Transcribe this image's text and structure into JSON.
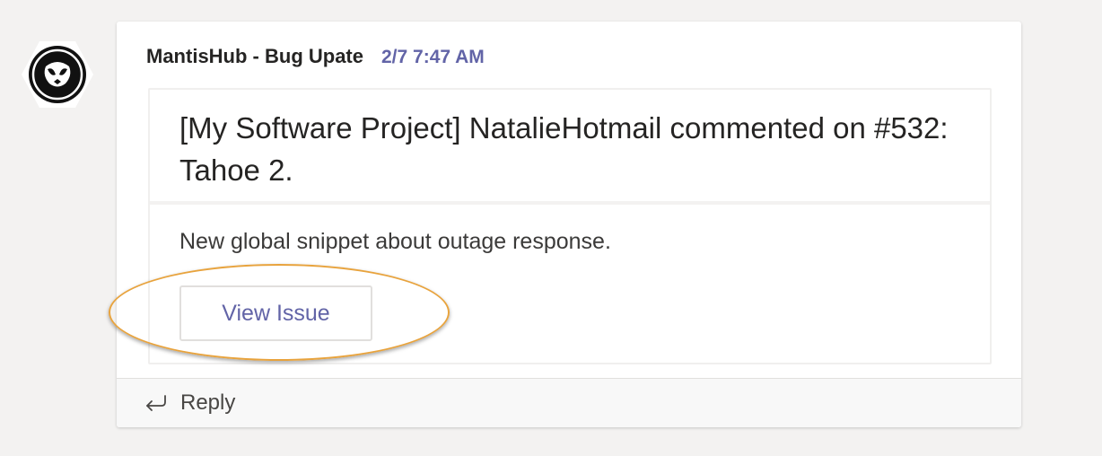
{
  "message": {
    "sender": "MantisHub - Bug Upate",
    "timestamp": "2/7 7:47 AM",
    "avatar_icon": "mantis-logo-icon"
  },
  "card": {
    "title": "[My Software Project] NatalieHotmail commented on #532: Tahoe 2.",
    "text": "New global snippet about outage response.",
    "button_label": "View Issue"
  },
  "reply": {
    "label": "Reply",
    "icon": "reply-arrow-icon"
  },
  "colors": {
    "accent": "#6264a7",
    "highlight_ring": "#e8a33d",
    "background": "#f3f2f1"
  }
}
